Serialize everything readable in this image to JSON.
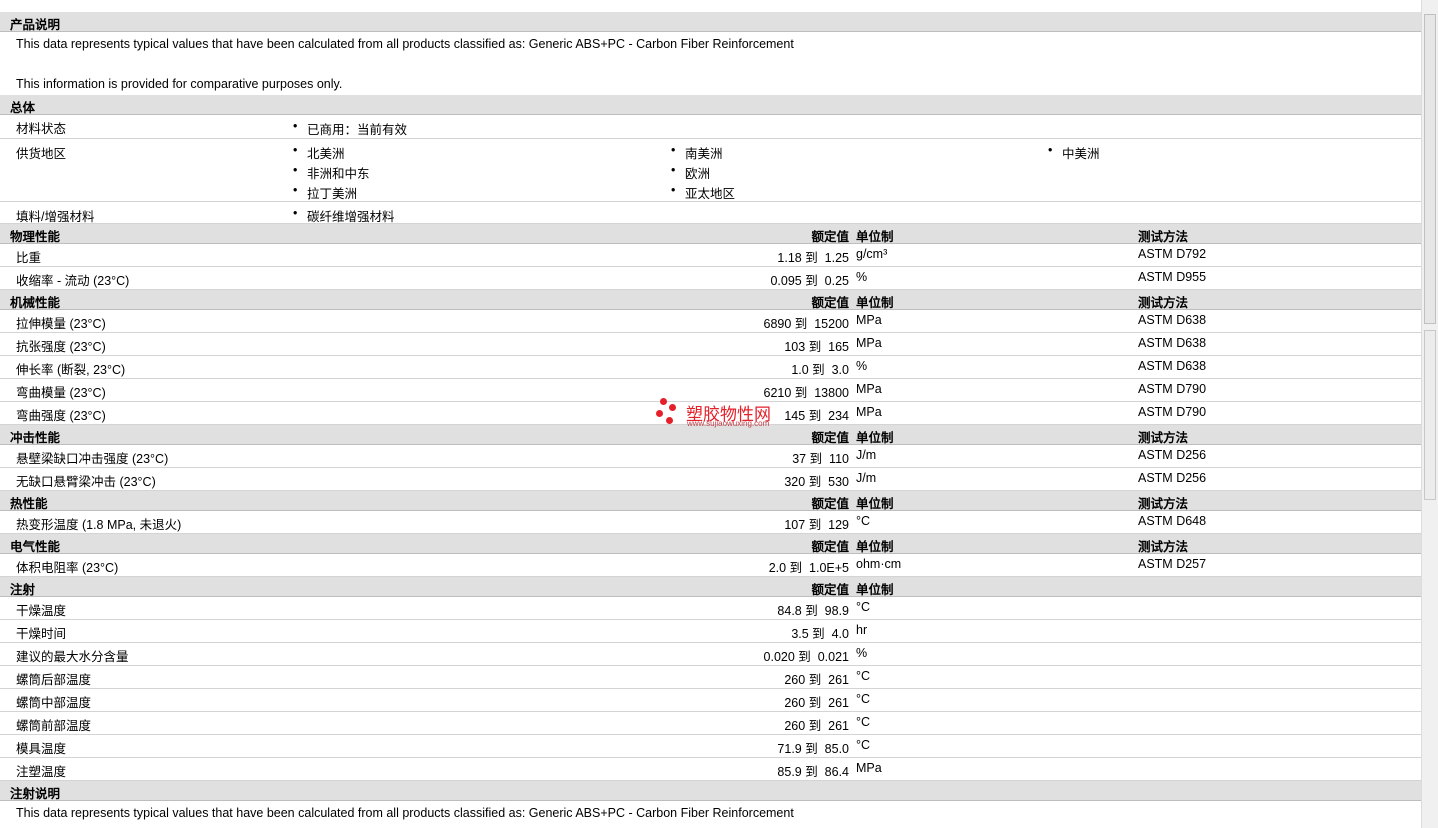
{
  "sections": {
    "product_desc": {
      "title": "产品说明",
      "line1": "This data represents typical values that have been calculated from all products classified as: Generic ABS+PC - Carbon Fiber Reinforcement",
      "line2": "This information is provided for comparative purposes only."
    },
    "general": {
      "title": "总体",
      "status_label": "材料状态",
      "status_value": "已商用：当前有效",
      "region_label": "供货地区",
      "regions": [
        "北美洲",
        "南美洲",
        "中美洲",
        "非洲和中东",
        "欧洲",
        "拉丁美洲",
        "亚太地区"
      ],
      "filler_label": "填料/增强材料",
      "filler_value": "碳纤维增强材料"
    },
    "headers": {
      "value": "额定值",
      "unit": "单位制",
      "method": "测试方法"
    },
    "physical": {
      "title": "物理性能",
      "rows": [
        {
          "label": "比重",
          "value": "1.18 到  1.25",
          "unit": "g/cm³",
          "method": "ASTM D792"
        },
        {
          "label": "收缩率  - 流动  (23°C)",
          "value": "0.095 到  0.25",
          "unit": "%",
          "method": "ASTM D955"
        }
      ]
    },
    "mechanical": {
      "title": "机械性能",
      "rows": [
        {
          "label": "拉伸模量  (23°C)",
          "value": "6890 到  15200",
          "unit": "MPa",
          "method": "ASTM D638"
        },
        {
          "label": "抗张强度  (23°C)",
          "value": "103 到  165",
          "unit": "MPa",
          "method": "ASTM D638"
        },
        {
          "label": "伸长率  (断裂, 23°C)",
          "value": "1.0 到  3.0",
          "unit": "%",
          "method": "ASTM D638"
        },
        {
          "label": "弯曲模量  (23°C)",
          "value": "6210 到  13800",
          "unit": "MPa",
          "method": "ASTM D790"
        },
        {
          "label": "弯曲强度  (23°C)",
          "value": "145 到  234",
          "unit": "MPa",
          "method": "ASTM D790"
        }
      ]
    },
    "impact": {
      "title": "冲击性能",
      "rows": [
        {
          "label": "悬壁梁缺口冲击强度  (23°C)",
          "value": "37 到  110",
          "unit": "J/m",
          "method": "ASTM D256"
        },
        {
          "label": "无缺口悬臂梁冲击  (23°C)",
          "value": "320 到  530",
          "unit": "J/m",
          "method": "ASTM D256"
        }
      ]
    },
    "thermal": {
      "title": "热性能",
      "rows": [
        {
          "label": "热变形温度  (1.8 MPa, 未退火)",
          "value": "107 到  129",
          "unit": "°C",
          "method": "ASTM D648"
        }
      ]
    },
    "electrical": {
      "title": "电气性能",
      "rows": [
        {
          "label": "体积电阻率  (23°C)",
          "value": "2.0 到  1.0E+5",
          "unit": "ohm·cm",
          "method": "ASTM D257"
        }
      ]
    },
    "injection": {
      "title": "注射",
      "rows": [
        {
          "label": "干燥温度",
          "value": "84.8 到  98.9",
          "unit": "°C"
        },
        {
          "label": "干燥时间",
          "value": "3.5 到  4.0",
          "unit": "hr"
        },
        {
          "label": "建议的最大水分含量",
          "value": "0.020 到  0.021",
          "unit": "%"
        },
        {
          "label": "螺筒后部温度",
          "value": "260 到  261",
          "unit": "°C"
        },
        {
          "label": "螺筒中部温度",
          "value": "260 到  261",
          "unit": "°C"
        },
        {
          "label": "螺筒前部温度",
          "value": "260 到  261",
          "unit": "°C"
        },
        {
          "label": "模具温度",
          "value": "71.9 到  85.0",
          "unit": "°C"
        },
        {
          "label": "注塑温度",
          "value": "85.9 到  86.4",
          "unit": "MPa"
        }
      ]
    },
    "injection_desc": {
      "title": "注射说明",
      "line1": "This data represents typical values that have been calculated from all products classified as: Generic ABS+PC - Carbon Fiber Reinforcement"
    }
  },
  "watermark": {
    "cn": "塑胶物性网",
    "en": "www.sujiaowuxing.com",
    "color": "#e4202a"
  }
}
